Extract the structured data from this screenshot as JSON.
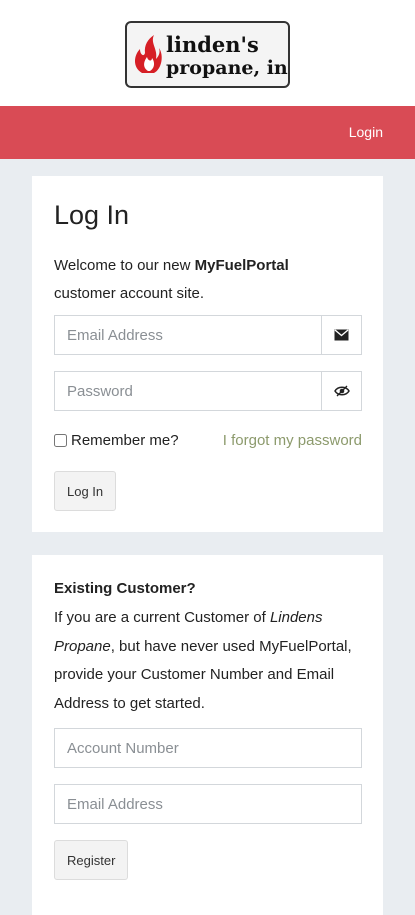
{
  "brand": {
    "logo_line1": "linden's",
    "logo_line2": "propane, inc",
    "accent": "#d94b55"
  },
  "nav": {
    "login_label": "Login"
  },
  "login_card": {
    "title": "Log In",
    "welcome_prefix": "Welcome to our new ",
    "welcome_brand": "MyFuelPortal",
    "welcome_suffix": "customer account site.",
    "email_placeholder": "Email Address",
    "email_icon": "envelope-icon",
    "password_placeholder": "Password",
    "password_icon": "eye-icon",
    "remember_label": "Remember me?",
    "forgot_label": "I forgot my password",
    "login_button": "Log In"
  },
  "register_card": {
    "title": "Existing Customer?",
    "text_1": "If you are a current Customer of ",
    "text_company": "Lindens Propane",
    "text_2": ", but have never used MyFuelPortal, provide your Customer Number and Email Address to get started.",
    "account_placeholder": "Account Number",
    "email_placeholder": "Email Address",
    "register_button": "Register"
  }
}
